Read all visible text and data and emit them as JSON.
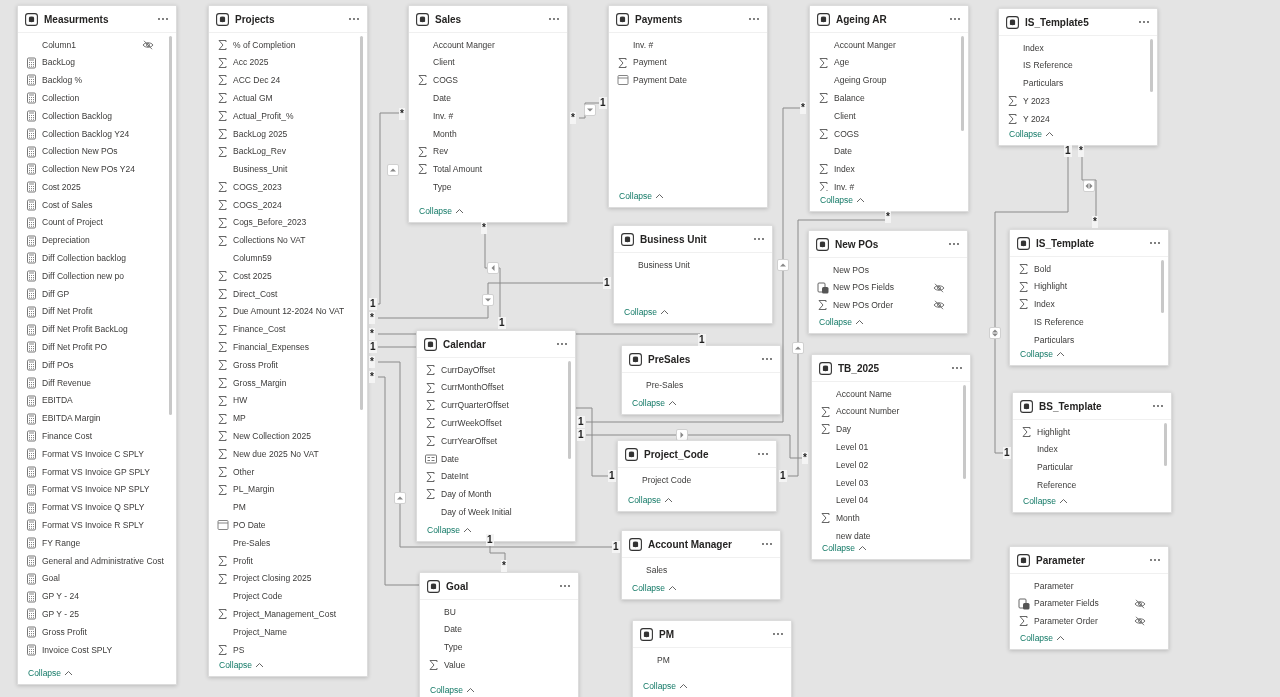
{
  "tables": [
    {
      "name": "Measurments",
      "scrollbar": true,
      "collapse_label": "Collapse",
      "fields": [
        {
          "name": "Column1",
          "kind": "text",
          "hidden": true
        },
        {
          "name": "BackLog",
          "kind": "measure",
          "hidden": false
        },
        {
          "name": "Backlog %",
          "kind": "measure",
          "hidden": false
        },
        {
          "name": "Collection",
          "kind": "measure",
          "hidden": false
        },
        {
          "name": "Collection Backlog",
          "kind": "measure",
          "hidden": false
        },
        {
          "name": "Collection Backlog Y24",
          "kind": "measure",
          "hidden": false
        },
        {
          "name": "Collection New POs",
          "kind": "measure",
          "hidden": false
        },
        {
          "name": "Collection New POs Y24",
          "kind": "measure",
          "hidden": false
        },
        {
          "name": "Cost 2025",
          "kind": "measure",
          "hidden": false
        },
        {
          "name": "Cost of Sales",
          "kind": "measure",
          "hidden": false
        },
        {
          "name": "Count of Project",
          "kind": "measure",
          "hidden": false
        },
        {
          "name": "Depreciation",
          "kind": "measure",
          "hidden": false
        },
        {
          "name": "Diff Collection backlog",
          "kind": "measure",
          "hidden": false
        },
        {
          "name": "Diff Collection new po",
          "kind": "measure",
          "hidden": false
        },
        {
          "name": "Diff GP",
          "kind": "measure",
          "hidden": false
        },
        {
          "name": "Diff Net Profit",
          "kind": "measure",
          "hidden": false
        },
        {
          "name": "Diff Net Profit BackLog",
          "kind": "measure",
          "hidden": false
        },
        {
          "name": "Diff Net Profit PO",
          "kind": "measure",
          "hidden": false
        },
        {
          "name": "Diff POs",
          "kind": "measure",
          "hidden": false
        },
        {
          "name": "Diff Revenue",
          "kind": "measure",
          "hidden": false
        },
        {
          "name": "EBITDA",
          "kind": "measure",
          "hidden": false
        },
        {
          "name": "EBITDA Margin",
          "kind": "measure",
          "hidden": false
        },
        {
          "name": "Finance Cost",
          "kind": "measure",
          "hidden": false
        },
        {
          "name": "Format VS Invoice C SPLY",
          "kind": "measure",
          "hidden": false
        },
        {
          "name": "Format VS Invoice GP SPLY",
          "kind": "measure",
          "hidden": false
        },
        {
          "name": "Format VS Invoice NP SPLY",
          "kind": "measure",
          "hidden": false
        },
        {
          "name": "Format VS Invoice Q SPLY",
          "kind": "measure",
          "hidden": false
        },
        {
          "name": "Format VS Invoice R SPLY",
          "kind": "measure",
          "hidden": false
        },
        {
          "name": "FY Range",
          "kind": "measure",
          "hidden": false
        },
        {
          "name": "General and Administrative Cost",
          "kind": "measure",
          "hidden": false
        },
        {
          "name": "Goal",
          "kind": "measure",
          "hidden": false
        },
        {
          "name": "GP Y - 24",
          "kind": "measure",
          "hidden": false
        },
        {
          "name": "GP Y - 25",
          "kind": "measure",
          "hidden": false
        },
        {
          "name": "Gross Profit",
          "kind": "measure",
          "hidden": false
        },
        {
          "name": "Invoice Cost SPLY",
          "kind": "measure",
          "hidden": false
        }
      ]
    },
    {
      "name": "Projects",
      "scrollbar": true,
      "collapse_label": "Collapse",
      "fields": [
        {
          "name": "% of Completion",
          "kind": "sum",
          "hidden": false
        },
        {
          "name": "Acc 2025",
          "kind": "sum",
          "hidden": false
        },
        {
          "name": "ACC Dec 24",
          "kind": "sum",
          "hidden": false
        },
        {
          "name": "Actual GM",
          "kind": "sum",
          "hidden": false
        },
        {
          "name": "Actual_Profit_%",
          "kind": "sum",
          "hidden": false
        },
        {
          "name": "BackLog 2025",
          "kind": "sum",
          "hidden": false
        },
        {
          "name": "BackLog_Rev",
          "kind": "sum",
          "hidden": false
        },
        {
          "name": "Business_Unit",
          "kind": "text",
          "hidden": false
        },
        {
          "name": "COGS_2023",
          "kind": "sum",
          "hidden": false
        },
        {
          "name": "COGS_2024",
          "kind": "sum",
          "hidden": false
        },
        {
          "name": "Cogs_Before_2023",
          "kind": "sum",
          "hidden": false
        },
        {
          "name": "Collections No VAT",
          "kind": "sum",
          "hidden": false
        },
        {
          "name": "Column59",
          "kind": "text",
          "hidden": false
        },
        {
          "name": "Cost 2025",
          "kind": "sum",
          "hidden": false
        },
        {
          "name": "Direct_Cost",
          "kind": "sum",
          "hidden": false
        },
        {
          "name": "Due Amount 12-2024 No VAT",
          "kind": "sum",
          "hidden": false
        },
        {
          "name": "Finance_Cost",
          "kind": "sum",
          "hidden": false
        },
        {
          "name": "Financial_Expenses",
          "kind": "sum",
          "hidden": false
        },
        {
          "name": "Gross Profit",
          "kind": "sum",
          "hidden": false
        },
        {
          "name": "Gross_Margin",
          "kind": "sum",
          "hidden": false
        },
        {
          "name": "HW",
          "kind": "sum",
          "hidden": false
        },
        {
          "name": "MP",
          "kind": "sum",
          "hidden": false
        },
        {
          "name": "New Collection 2025",
          "kind": "sum",
          "hidden": false
        },
        {
          "name": "New due 2025 No VAT",
          "kind": "sum",
          "hidden": false
        },
        {
          "name": "Other",
          "kind": "sum",
          "hidden": false
        },
        {
          "name": "PL_Margin",
          "kind": "sum",
          "hidden": false
        },
        {
          "name": "PM",
          "kind": "text",
          "hidden": false
        },
        {
          "name": "PO Date",
          "kind": "date",
          "hidden": false
        },
        {
          "name": "Pre-Sales",
          "kind": "text",
          "hidden": false
        },
        {
          "name": "Profit",
          "kind": "sum",
          "hidden": false
        },
        {
          "name": "Project Closing 2025",
          "kind": "sum",
          "hidden": false
        },
        {
          "name": "Project Code",
          "kind": "text",
          "hidden": false
        },
        {
          "name": "Project_Management_Cost",
          "kind": "sum",
          "hidden": false
        },
        {
          "name": "Project_Name",
          "kind": "text",
          "hidden": false
        },
        {
          "name": "PS",
          "kind": "sum",
          "hidden": false
        }
      ]
    },
    {
      "name": "Sales",
      "scrollbar": false,
      "collapse_label": "Collapse",
      "fields": [
        {
          "name": "Account Manger",
          "kind": "text",
          "hidden": false
        },
        {
          "name": "Client",
          "kind": "text",
          "hidden": false
        },
        {
          "name": "COGS",
          "kind": "sum",
          "hidden": false
        },
        {
          "name": "Date",
          "kind": "text",
          "hidden": false
        },
        {
          "name": "Inv. #",
          "kind": "text",
          "hidden": false
        },
        {
          "name": "Month",
          "kind": "text",
          "hidden": false
        },
        {
          "name": "Rev",
          "kind": "sum",
          "hidden": false
        },
        {
          "name": "Total Amount",
          "kind": "sum",
          "hidden": false
        },
        {
          "name": "Type",
          "kind": "text",
          "hidden": false
        }
      ]
    },
    {
      "name": "Payments",
      "scrollbar": false,
      "collapse_label": "Collapse",
      "fields": [
        {
          "name": "Inv. #",
          "kind": "text",
          "hidden": false
        },
        {
          "name": "Payment",
          "kind": "sum",
          "hidden": false
        },
        {
          "name": "Payment Date",
          "kind": "date",
          "hidden": false
        }
      ]
    },
    {
      "name": "Ageing AR",
      "scrollbar": true,
      "collapse_label": "Collapse",
      "fields": [
        {
          "name": "Account Manger",
          "kind": "text",
          "hidden": false
        },
        {
          "name": "Age",
          "kind": "sum",
          "hidden": false
        },
        {
          "name": "Ageing Group",
          "kind": "text",
          "hidden": false
        },
        {
          "name": "Balance",
          "kind": "sum",
          "hidden": false
        },
        {
          "name": "Client",
          "kind": "text",
          "hidden": false
        },
        {
          "name": "COGS",
          "kind": "sum",
          "hidden": false
        },
        {
          "name": "Date",
          "kind": "text",
          "hidden": false
        },
        {
          "name": "Index",
          "kind": "sum",
          "hidden": false
        },
        {
          "name": "Inv. #",
          "kind": "sum",
          "hidden": false
        }
      ]
    },
    {
      "name": "IS_Template5",
      "scrollbar": true,
      "collapse_label": "Collapse",
      "fields": [
        {
          "name": "Index",
          "kind": "text",
          "hidden": false
        },
        {
          "name": "IS Reference",
          "kind": "text",
          "hidden": false
        },
        {
          "name": "Particulars",
          "kind": "text",
          "hidden": false
        },
        {
          "name": "Y 2023",
          "kind": "sum",
          "hidden": false
        },
        {
          "name": "Y 2024",
          "kind": "sum",
          "hidden": false
        }
      ]
    },
    {
      "name": "Business Unit",
      "scrollbar": false,
      "collapse_label": "Collapse",
      "fields": [
        {
          "name": "Business Unit",
          "kind": "text",
          "hidden": false
        }
      ]
    },
    {
      "name": "New POs",
      "scrollbar": false,
      "collapse_label": "Collapse",
      "fields": [
        {
          "name": "New POs",
          "kind": "text",
          "hidden": false
        },
        {
          "name": "New POs Fields",
          "kind": "fields",
          "hidden": true
        },
        {
          "name": "New POs Order",
          "kind": "sum",
          "hidden": true
        }
      ]
    },
    {
      "name": "IS_Template",
      "scrollbar": true,
      "collapse_label": "Collapse",
      "fields": [
        {
          "name": "Bold",
          "kind": "sum",
          "hidden": false
        },
        {
          "name": "Highlight",
          "kind": "sum",
          "hidden": false
        },
        {
          "name": "Index",
          "kind": "sum",
          "hidden": false
        },
        {
          "name": "IS Reference",
          "kind": "text",
          "hidden": false
        },
        {
          "name": "Particulars",
          "kind": "text",
          "hidden": false
        }
      ]
    },
    {
      "name": "Calendar",
      "scrollbar": true,
      "collapse_label": "Collapse",
      "fields": [
        {
          "name": "CurrDayOffset",
          "kind": "sum",
          "hidden": false
        },
        {
          "name": "CurrMonthOffset",
          "kind": "sum",
          "hidden": false
        },
        {
          "name": "CurrQuarterOffset",
          "kind": "sum",
          "hidden": false
        },
        {
          "name": "CurrWeekOffset",
          "kind": "sum",
          "hidden": false
        },
        {
          "name": "CurrYearOffset",
          "kind": "sum",
          "hidden": false
        },
        {
          "name": "Date",
          "kind": "hierarchy",
          "hidden": false
        },
        {
          "name": "DateInt",
          "kind": "sum",
          "hidden": false
        },
        {
          "name": "Day of Month",
          "kind": "sum",
          "hidden": false
        },
        {
          "name": "Day of Week Initial",
          "kind": "text",
          "hidden": false
        }
      ]
    },
    {
      "name": "PreSales",
      "scrollbar": false,
      "collapse_label": "Collapse",
      "fields": [
        {
          "name": "Pre-Sales",
          "kind": "text",
          "hidden": false
        }
      ]
    },
    {
      "name": "Project_Code",
      "scrollbar": false,
      "collapse_label": "Collapse",
      "fields": [
        {
          "name": "Project Code",
          "kind": "text",
          "hidden": false
        }
      ]
    },
    {
      "name": "TB_2025",
      "scrollbar": true,
      "collapse_label": "Collapse",
      "fields": [
        {
          "name": "Account Name",
          "kind": "text",
          "hidden": false
        },
        {
          "name": "Account Number",
          "kind": "sum",
          "hidden": false
        },
        {
          "name": "Day",
          "kind": "sum",
          "hidden": false
        },
        {
          "name": "Level 01",
          "kind": "text",
          "hidden": false
        },
        {
          "name": "Level 02",
          "kind": "text",
          "hidden": false
        },
        {
          "name": "Level 03",
          "kind": "text",
          "hidden": false
        },
        {
          "name": "Level 04",
          "kind": "text",
          "hidden": false
        },
        {
          "name": "Month",
          "kind": "sum",
          "hidden": false
        },
        {
          "name": "new date",
          "kind": "text",
          "hidden": false
        }
      ]
    },
    {
      "name": "BS_Template",
      "scrollbar": true,
      "collapse_label": "Collapse",
      "fields": [
        {
          "name": "Highlight",
          "kind": "sum",
          "hidden": false
        },
        {
          "name": "Index",
          "kind": "text",
          "hidden": false
        },
        {
          "name": "Particular",
          "kind": "text",
          "hidden": false
        },
        {
          "name": "Reference",
          "kind": "text",
          "hidden": false
        }
      ]
    },
    {
      "name": "Goal",
      "scrollbar": false,
      "collapse_label": "Collapse",
      "fields": [
        {
          "name": "BU",
          "kind": "text",
          "hidden": false
        },
        {
          "name": "Date",
          "kind": "text",
          "hidden": false
        },
        {
          "name": "Type",
          "kind": "text",
          "hidden": false
        },
        {
          "name": "Value",
          "kind": "sum",
          "hidden": false
        }
      ]
    },
    {
      "name": "Account Manager",
      "scrollbar": false,
      "collapse_label": "Collapse",
      "fields": [
        {
          "name": "Sales",
          "kind": "text",
          "hidden": false
        }
      ]
    },
    {
      "name": "PM",
      "scrollbar": false,
      "collapse_label": "Collapse",
      "fields": [
        {
          "name": "PM",
          "kind": "text",
          "hidden": false
        }
      ]
    },
    {
      "name": "Parameter",
      "scrollbar": false,
      "collapse_label": "Collapse",
      "fields": [
        {
          "name": "Parameter",
          "kind": "text",
          "hidden": false
        },
        {
          "name": "Parameter Fields",
          "kind": "fields",
          "hidden": true
        },
        {
          "name": "Parameter Order",
          "kind": "sum",
          "hidden": true
        }
      ]
    }
  ],
  "relationships": [
    {
      "ends": [
        "1",
        "*"
      ]
    },
    {
      "ends": [
        "*",
        "1"
      ]
    },
    {
      "ends": [
        "*",
        "1"
      ]
    },
    {
      "ends": [
        "*",
        "1"
      ]
    },
    {
      "ends": [
        "*",
        "1"
      ]
    },
    {
      "ends": [
        "1"
      ]
    },
    {
      "ends": [
        "*",
        "1"
      ]
    },
    {
      "ends": [
        "*"
      ]
    },
    {
      "ends": [
        "1"
      ]
    },
    {
      "ends": [
        "1",
        "*"
      ]
    },
    {
      "ends": [
        "1",
        "*"
      ]
    },
    {
      "ends": [
        "1",
        "*"
      ]
    },
    {
      "ends": [
        "1",
        "1"
      ]
    },
    {
      "ends": [
        "*",
        "*"
      ]
    },
    {
      "ends": [
        "1",
        "*"
      ]
    }
  ]
}
